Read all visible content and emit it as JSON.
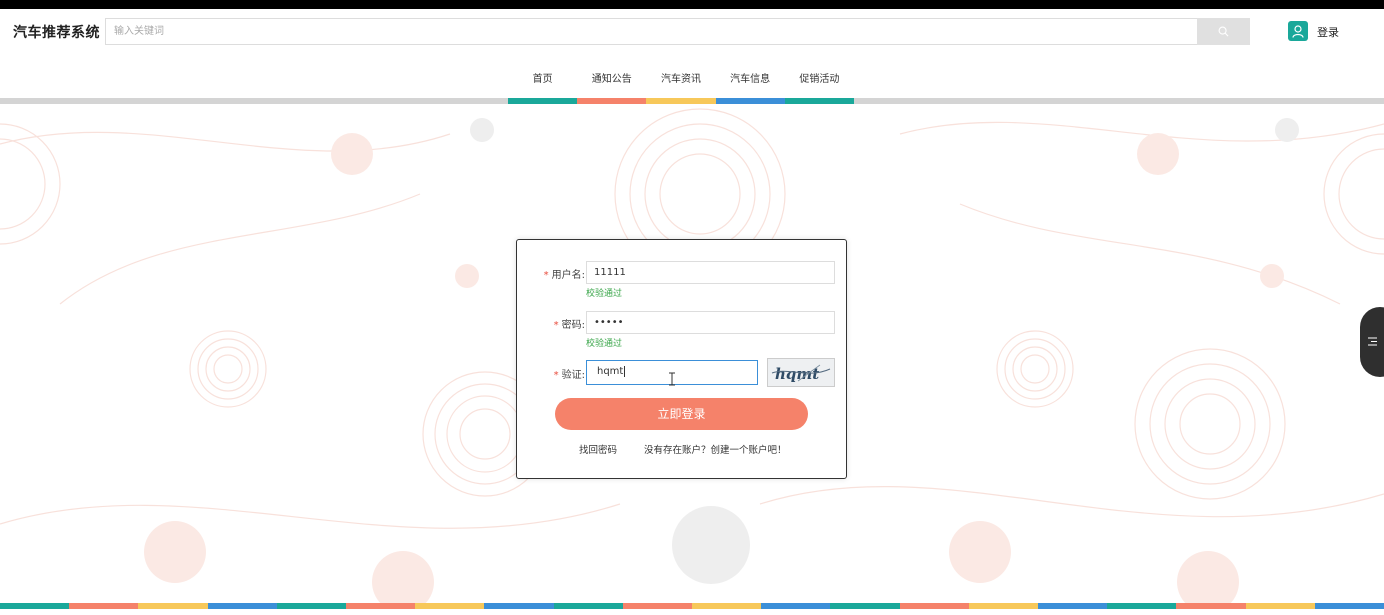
{
  "header": {
    "site_title": "汽车推荐系统",
    "search_placeholder": "输入关键词",
    "login_label": "登录",
    "icons": {
      "search": "search-icon",
      "user": "user-icon"
    }
  },
  "nav": {
    "items": [
      {
        "label": "首页",
        "color": "#1aa89a"
      },
      {
        "label": "通知公告",
        "color": "#f5826a"
      },
      {
        "label": "汽车资讯",
        "color": "#f7c85a"
      },
      {
        "label": "汽车信息",
        "color": "#3b8fd8"
      },
      {
        "label": "促销活动",
        "color": "#1aa89a"
      }
    ]
  },
  "login_form": {
    "username": {
      "label": "用户名:",
      "value": "11111",
      "validation": "校验通过"
    },
    "password": {
      "label": "密码:",
      "value": "•••••",
      "validation": "校验通过"
    },
    "captcha": {
      "label": "验证:",
      "value": "hqmt",
      "image_text": "hqmt"
    },
    "submit_label": "立即登录",
    "forgot_link": "找回密码",
    "register_link": "没有存在账户？创建一个账户吧！"
  },
  "colors": {
    "accent": "#f5826a",
    "teal": "#1aa89a",
    "yellow": "#f7c85a",
    "blue": "#3b8fd8",
    "valid_green": "#3aa64a"
  }
}
